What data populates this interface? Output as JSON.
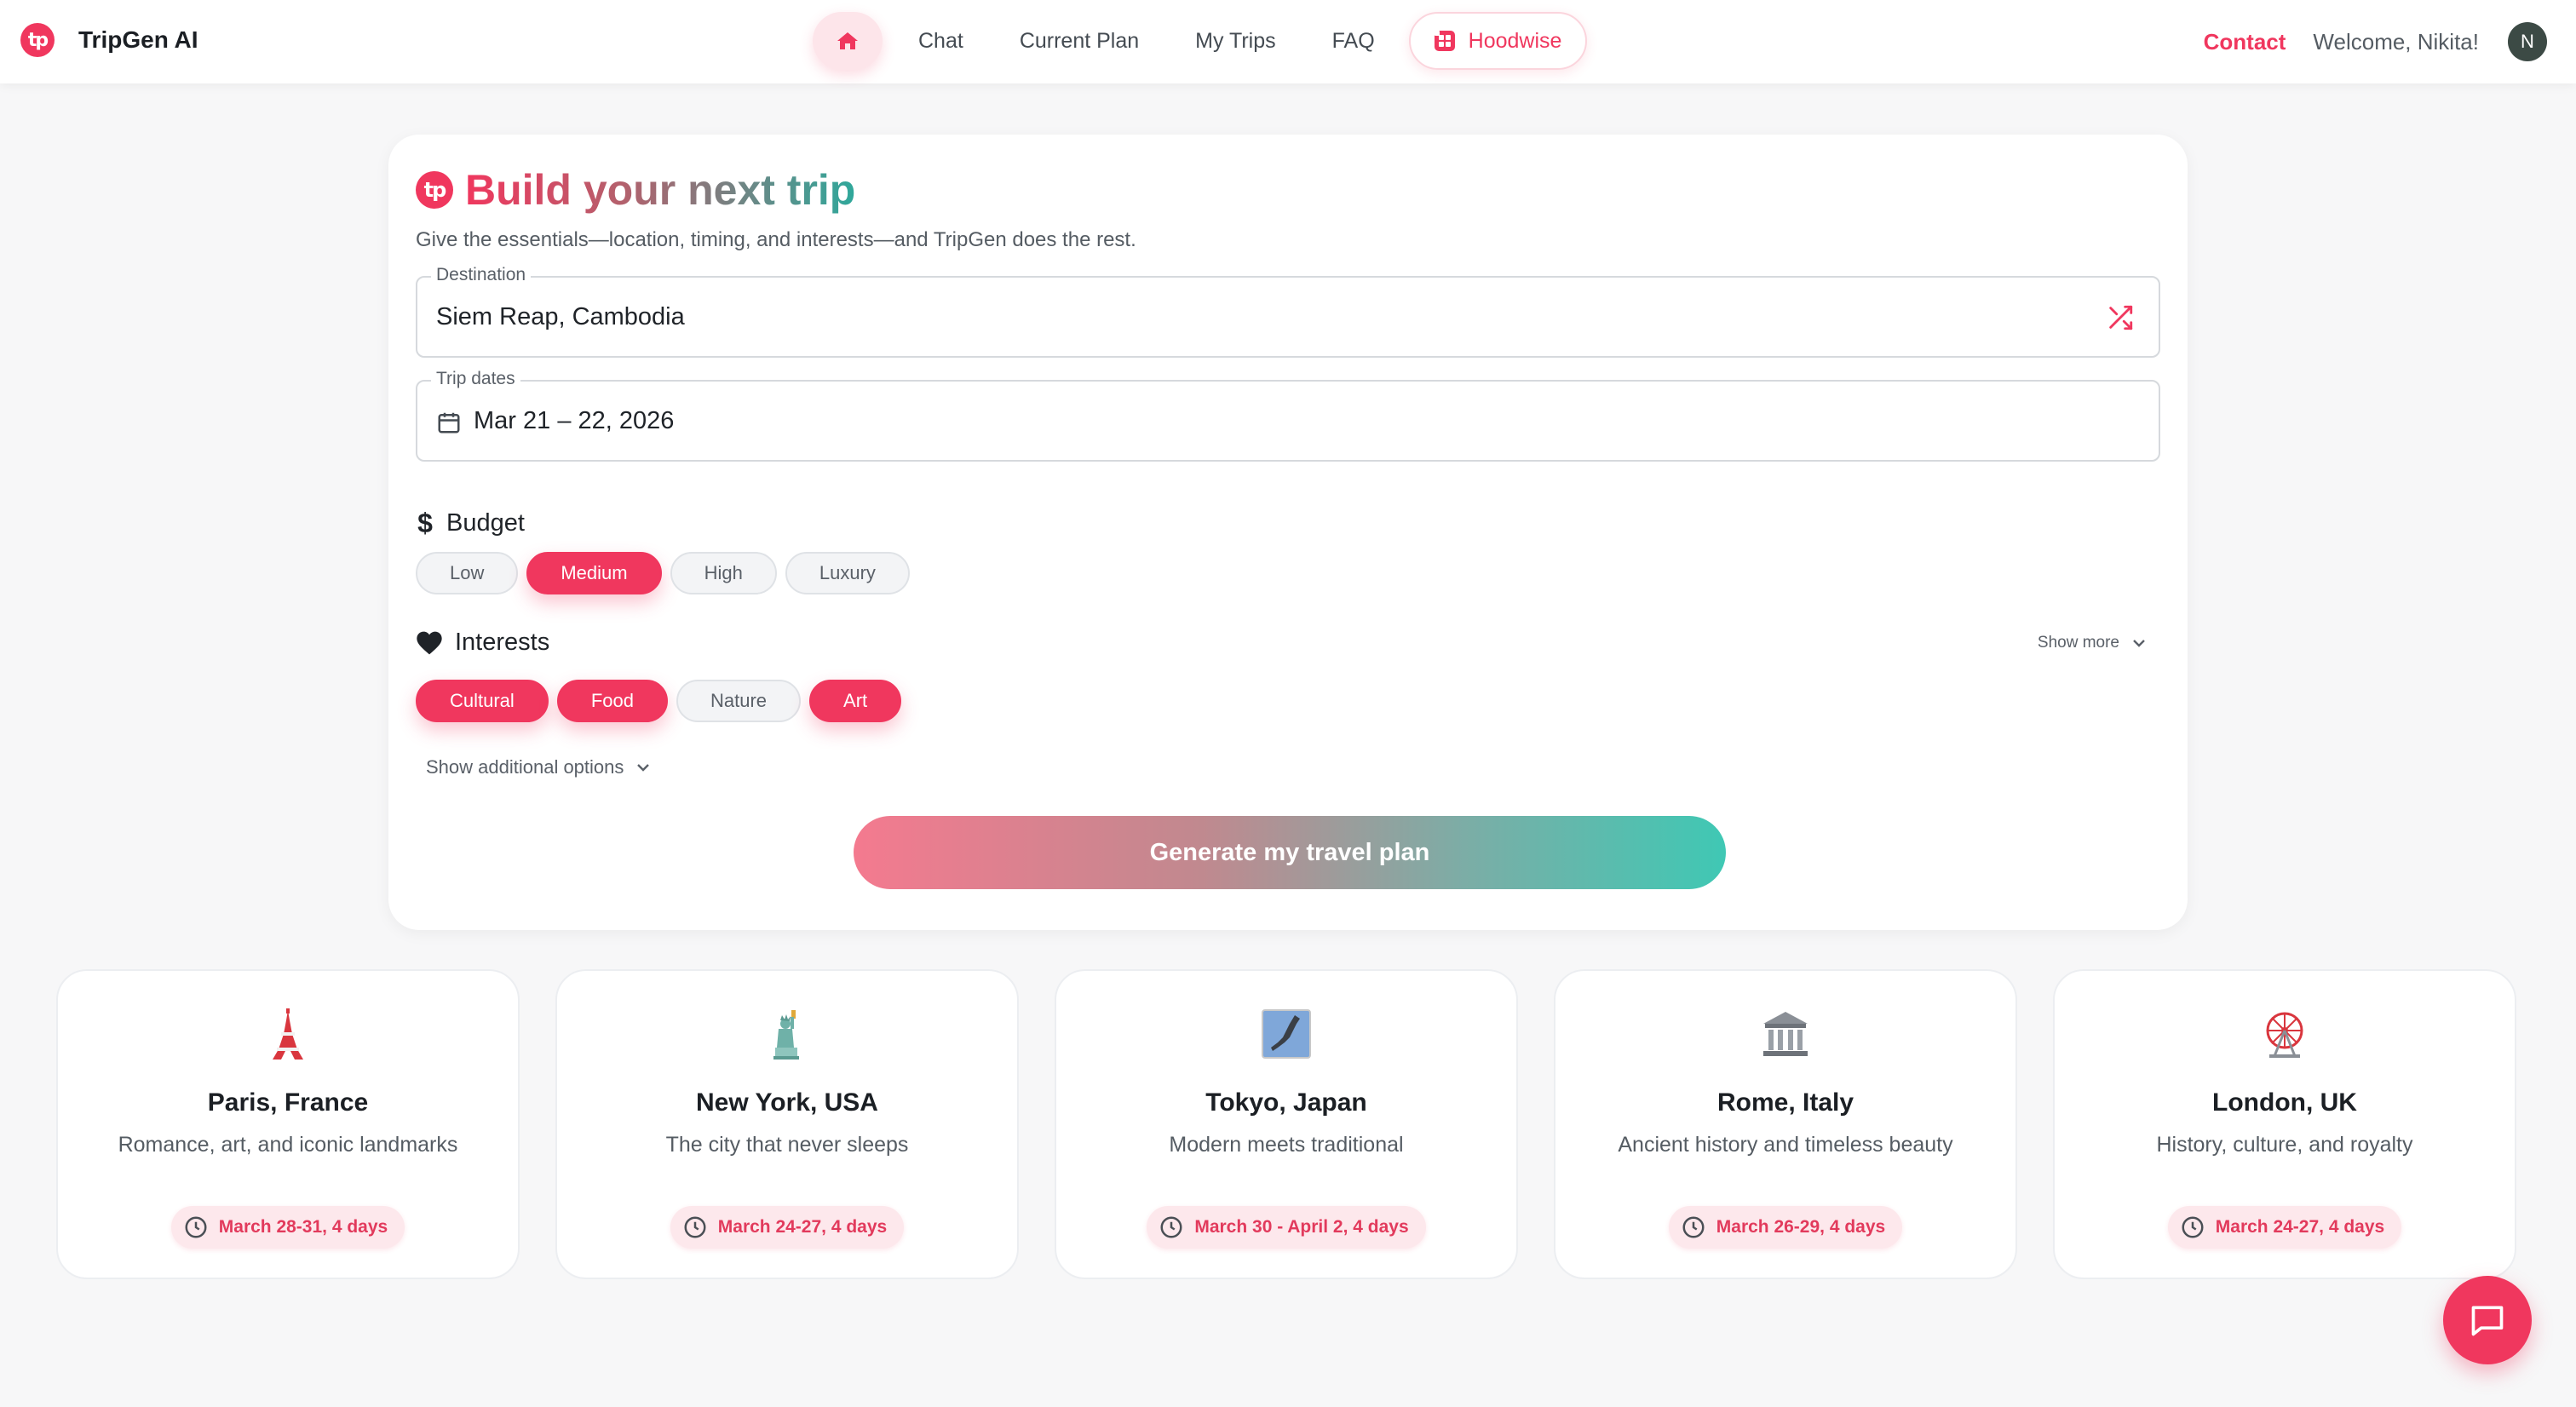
{
  "nav": {
    "brand": "TripGen AI",
    "logo_text": "tp",
    "links": [
      "Chat",
      "Current Plan",
      "My Trips",
      "FAQ"
    ],
    "hoodwise": "Hoodwise",
    "contact": "Contact",
    "welcome": "Welcome, Nikita!",
    "avatar_initial": "N"
  },
  "form": {
    "logo_text": "tp",
    "title": "Build your next trip",
    "subtitle": "Give the essentials—location, timing, and interests—and TripGen does the rest.",
    "destination": {
      "label": "Destination",
      "value": "Siem Reap, Cambodia"
    },
    "dates": {
      "label": "Trip dates",
      "value": "Mar 21 – 22, 2026"
    },
    "budget": {
      "label": "Budget",
      "options": [
        {
          "label": "Low",
          "selected": false
        },
        {
          "label": "Medium",
          "selected": true
        },
        {
          "label": "High",
          "selected": false
        },
        {
          "label": "Luxury",
          "selected": false
        }
      ]
    },
    "interests": {
      "label": "Interests",
      "show_more": "Show more",
      "options": [
        {
          "label": "Cultural",
          "selected": true
        },
        {
          "label": "Food",
          "selected": true
        },
        {
          "label": "Nature",
          "selected": false
        },
        {
          "label": "Art",
          "selected": true
        }
      ]
    },
    "show_additional": "Show additional options",
    "generate": "Generate my travel plan"
  },
  "destinations": [
    {
      "title": "Paris, France",
      "desc": "Romance, art, and iconic landmarks",
      "dates": "March 28-31, 4 days",
      "icon": "tower-icon"
    },
    {
      "title": "New York, USA",
      "desc": "The city that never sleeps",
      "dates": "March 24-27, 4 days",
      "icon": "statue-of-liberty-icon"
    },
    {
      "title": "Tokyo, Japan",
      "desc": "Modern meets traditional",
      "dates": "March 30 - April 2, 4 days",
      "icon": "japan-map-icon"
    },
    {
      "title": "Rome, Italy",
      "desc": "Ancient history and timeless beauty",
      "dates": "March 26-29, 4 days",
      "icon": "classical-building-icon"
    },
    {
      "title": "London, UK",
      "desc": "History, culture, and royalty",
      "dates": "March 24-27, 4 days",
      "icon": "ferris-wheel-icon"
    }
  ],
  "colors": {
    "accent": "#f0375e",
    "teal": "#3fc8b4",
    "chip_selected": "#f0375e",
    "pill_bg": "#fde8ec"
  }
}
